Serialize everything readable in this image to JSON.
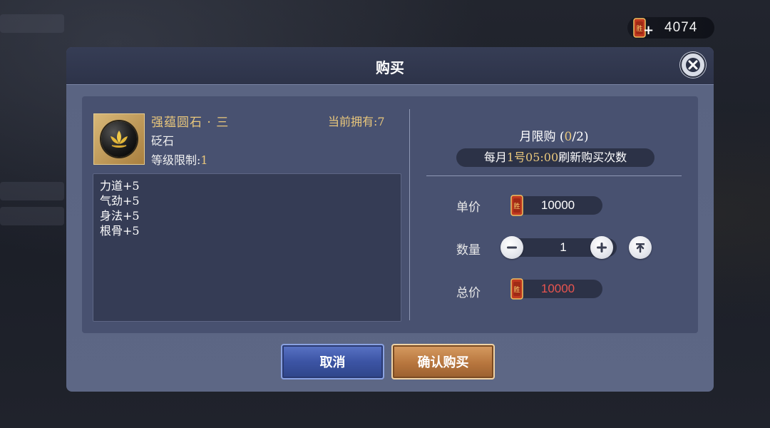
{
  "currency": {
    "amount": "4074",
    "plus": "+",
    "icon": "victory-token-icon"
  },
  "dialog": {
    "title": "购买",
    "close_icon": "close-icon"
  },
  "item": {
    "name": "强蕴圆石 · 三",
    "type": "砭石",
    "level_label": "等级限制:",
    "level_value": "1",
    "owned_label": "当前拥有:",
    "owned_value": "7",
    "stats": [
      "力道+5",
      "气劲+5",
      "身法+5",
      "根骨+5"
    ]
  },
  "purchase": {
    "limit_prefix": "月限购 (",
    "limit_used": "0",
    "limit_total": "/2)",
    "refresh_prefix": "每月",
    "refresh_day": "1号05:00",
    "refresh_suffix": "刷新购买次数",
    "unit_price_label": "单价",
    "unit_price": "10000",
    "quantity_label": "数量",
    "quantity": "1",
    "minus": "−",
    "plus": "+",
    "max": "⤒",
    "total_label": "总价",
    "total_price": "10000"
  },
  "buttons": {
    "cancel": "取消",
    "confirm": "确认购买"
  },
  "colors": {
    "gold": "#e9c77c",
    "red_price": "#e8544f",
    "panel": "#485170"
  }
}
